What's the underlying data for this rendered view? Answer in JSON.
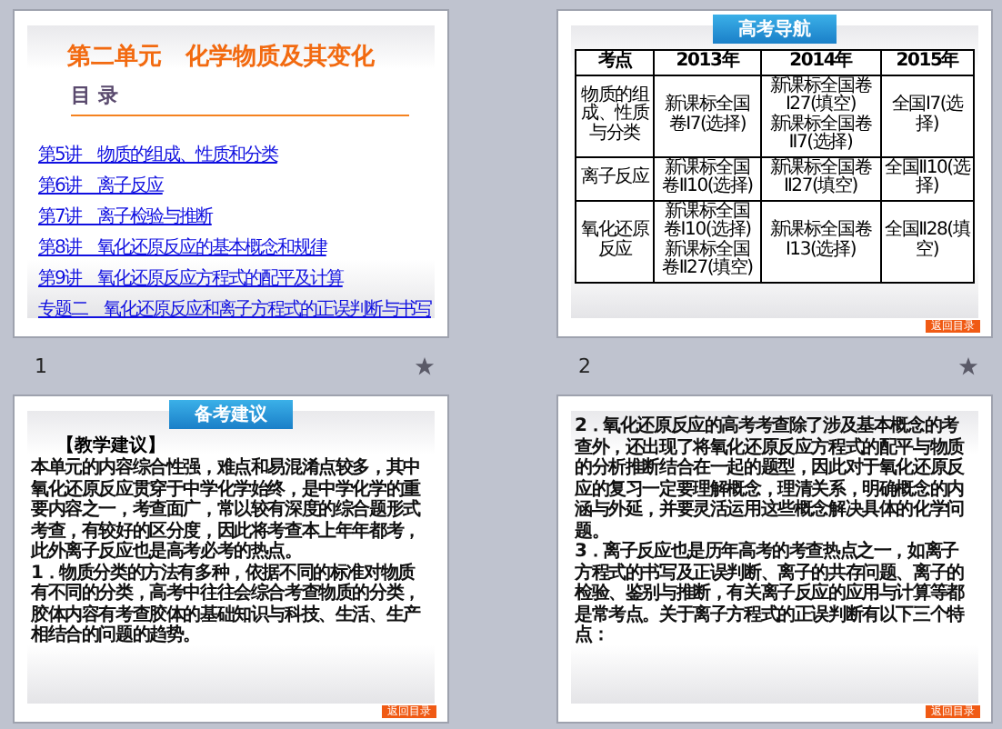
{
  "slides": [
    {
      "number": "1",
      "transition": true,
      "kind": "toc",
      "title": "第二单元　化学物质及其变化",
      "subtitle": "目 录",
      "links": [
        "第5讲　物质的组成、性质和分类",
        "第6讲　离子反应",
        "第7讲　离子检验与推断",
        "第8讲　氧化还原反应的基本概念和规律",
        "第9讲　氧化还原反应方程式的配平及计算",
        "专题二　氧化还原反应和离子方程式的正误判断与书写"
      ]
    },
    {
      "number": "2",
      "transition": true,
      "kind": "table",
      "badge": "高考导航",
      "columns": [
        "考点",
        "2013年",
        "2014年",
        "2015年"
      ],
      "rows": [
        [
          [
            "物质的组成、性质与分类"
          ],
          [
            "新课标全国卷Ⅰ7(选择)"
          ],
          [
            "新课标全国卷Ⅰ27(填空)",
            "新课标全国卷Ⅱ7(选择)"
          ],
          [
            "全国Ⅰ7(选择)"
          ]
        ],
        [
          [
            "离子反应"
          ],
          [
            "新课标全国卷Ⅱ10(选择)"
          ],
          [
            "新课标全国卷Ⅱ27(填空)"
          ],
          [
            "全国Ⅱ10(选择)"
          ]
        ],
        [
          [
            "氧化还原反应"
          ],
          [
            "新课标全国卷Ⅰ10(选择)",
            "新课标全国卷Ⅱ27(填空)"
          ],
          [
            "新课标全国卷Ⅰ13(选择)"
          ],
          [
            "全国Ⅱ28(填空)"
          ]
        ]
      ],
      "button": "返回目录"
    },
    {
      "kind": "text",
      "badge": "备考建议",
      "heading": "【教学建议】",
      "paragraphs": [
        "本单元的内容综合性强，难点和易混淆点较多，其中氧化还原反应贯穿于中学化学始终，是中学化学的重要内容之一，考查面广，常以较有深度的综合题形式考查，有较好的区分度，因此将考查本上年年都考，此外离子反应也是高考必考的热点。",
        "1．物质分类的方法有多种，依据不同的标准对物质有不同的分类，高考中往往会综合考查物质的分类，胶体内容有考查胶体的基础知识与科技、生活、生产相结合的问题的趋势。"
      ],
      "button": "返回目录"
    },
    {
      "kind": "text",
      "paragraphs": [
        "2．氧化还原反应的高考考查除了涉及基本概念的考查外，还出现了将氧化还原反应方程式的配平与物质的分析推断结合在一起的题型，因此对于氧化还原反应的复习一定要理解概念，理清关系，明确概念的内涵与外延，并要灵活运用这些概念解决具体的化学问题。",
        "3．离子反应也是历年高考的考查热点之一，如离子方程式的书写及正误判断、离子的共存问题、离子的检验、鉴别与推断，有关离子反应的应用与计算等都是常考点。关于离子方程式的正误判断有以下三个特点："
      ],
      "button": "返回目录"
    }
  ]
}
